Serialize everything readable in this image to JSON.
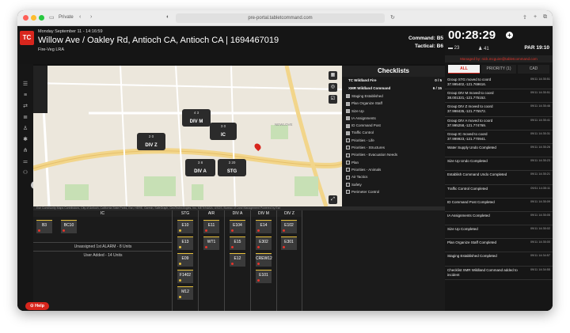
{
  "browser": {
    "mode_label": "Private",
    "url": "pre-portal.tabletcommand.com"
  },
  "header": {
    "logo": "TC",
    "date": "Monday September 11 - 14:16:59",
    "title": "Willow Ave / Oakley Rd, Antioch CA, Antioch CA | 1694467019",
    "subtitle": "Fire-Veg LRA",
    "command": "Command: B5",
    "tactical": "Tactical: B6"
  },
  "map": {
    "units": [
      {
        "name": "DIV M",
        "counts": "4  3"
      },
      {
        "name": "IC",
        "counts": "3  0"
      },
      {
        "name": "DIV Z",
        "counts": "2  0"
      },
      {
        "name": "DIV A",
        "counts": "3  8"
      },
      {
        "name": "STG",
        "counts": "3  20"
      }
    ],
    "attribution": "Esri Community Maps Contributors, City of Antioch, California State Parks, Esri, HERE, Garmin, SafeGraph, GeoTechnologies, Inc, METI/NASA, USGS, Bureau of Land Management     Powered by Esri",
    "street_label": "NEWLOVE"
  },
  "checklists": {
    "title": "Checklists",
    "groups": [
      {
        "label": "TC Wildland Fire",
        "count": "0 / 5"
      },
      {
        "label": "XMR Wildland Command",
        "count": "6 / 15"
      }
    ],
    "items": [
      {
        "label": "Staging Established",
        "checked": true
      },
      {
        "label": "Plan Organize Staff",
        "checked": true
      },
      {
        "label": "Size Up",
        "checked": true
      },
      {
        "label": "IA Assignments",
        "checked": true
      },
      {
        "label": "ID Command Post",
        "checked": true
      },
      {
        "label": "Traffic Control",
        "checked": true
      },
      {
        "label": "Priorities - Life",
        "checked": false
      },
      {
        "label": "Priorities - Structures",
        "checked": false
      },
      {
        "label": "Priorities - Evacuation Needs",
        "checked": false
      },
      {
        "label": "Plan",
        "checked": false
      },
      {
        "label": "Priorities - Animals",
        "checked": false
      },
      {
        "label": "Air Tactics",
        "checked": false
      },
      {
        "label": "Safety",
        "checked": false
      },
      {
        "label": "Perimeter Control",
        "checked": false
      }
    ]
  },
  "board": {
    "columns": [
      "IC",
      "STG",
      "AIR",
      "DIV A",
      "DIV M",
      "DIV Z"
    ],
    "ic_units": [
      "B3",
      "BC10"
    ],
    "ic_notes": [
      "Unassigned 1st ALARM - 8 Units",
      "User Added - 14 Units"
    ],
    "stg_units": [
      "E10",
      "E13",
      "E09",
      "F1402",
      "M12"
    ],
    "air_units": [
      "E11",
      "WT1"
    ],
    "diva_units": [
      "E104",
      "E15",
      "E12"
    ],
    "divm_units": [
      "E14",
      "E302",
      "CREW12",
      "E101"
    ],
    "divz_units": [
      "E102",
      "E301"
    ]
  },
  "right_panel": {
    "timer": "00:28:29",
    "stat_a": "23",
    "stat_b": "41",
    "par_label": "PAR",
    "par_value": "19:10",
    "managed": "Managed by: nick.mcguire@tabletcommand.com",
    "tabs": [
      "ALL",
      "PRIORITY (1)",
      "CAD"
    ],
    "messages": [
      {
        "text": "Group STG moved to coord 37.995402,-121.769616.",
        "time": "09/11 14:35:51"
      },
      {
        "text": "Group DIV M moved to coord 38.001321,-121.775152.",
        "time": "09/11 14:35:51"
      },
      {
        "text": "Group DIV Z moved to coord 37.998435,-121.775572.",
        "time": "09/11 14:35:46"
      },
      {
        "text": "Group DIV A moved to coord 37.995258,-121.774769.",
        "time": "09/11 14:35:41"
      },
      {
        "text": "Group IC moved to coord 37.999923,-121.770941.",
        "time": "09/11 14:35:31"
      },
      {
        "text": "Water Supply Undo Completed",
        "time": "09/11 14:35:26"
      },
      {
        "text": "Size Up Undo Completed",
        "time": "09/11 14:35:23"
      },
      {
        "text": "Establish Command Undo Completed",
        "time": "09/11 14:35:21"
      },
      {
        "text": "Traffic Control Completed",
        "time": "09/11 14:35:11"
      },
      {
        "text": "ID Command Post Completed",
        "time": "09/11 14:35:09"
      },
      {
        "text": "IA Assignments Completed",
        "time": "09/11 14:35:05"
      },
      {
        "text": "Size Up Completed",
        "time": "09/11 14:35:02"
      },
      {
        "text": "Plan Organize Staff Completed",
        "time": "09/11 14:35:00"
      },
      {
        "text": "Staging Established Completed",
        "time": "09/11 14:34:57"
      },
      {
        "text": "Checklist XMR Wildland Command added to incident",
        "time": "09/11 14:34:55"
      }
    ]
  },
  "help": {
    "label": "Help"
  },
  "colors": {
    "brand": "#d8261d",
    "unit_top": "#e8c13a",
    "unit_dot": "#e8342b"
  }
}
